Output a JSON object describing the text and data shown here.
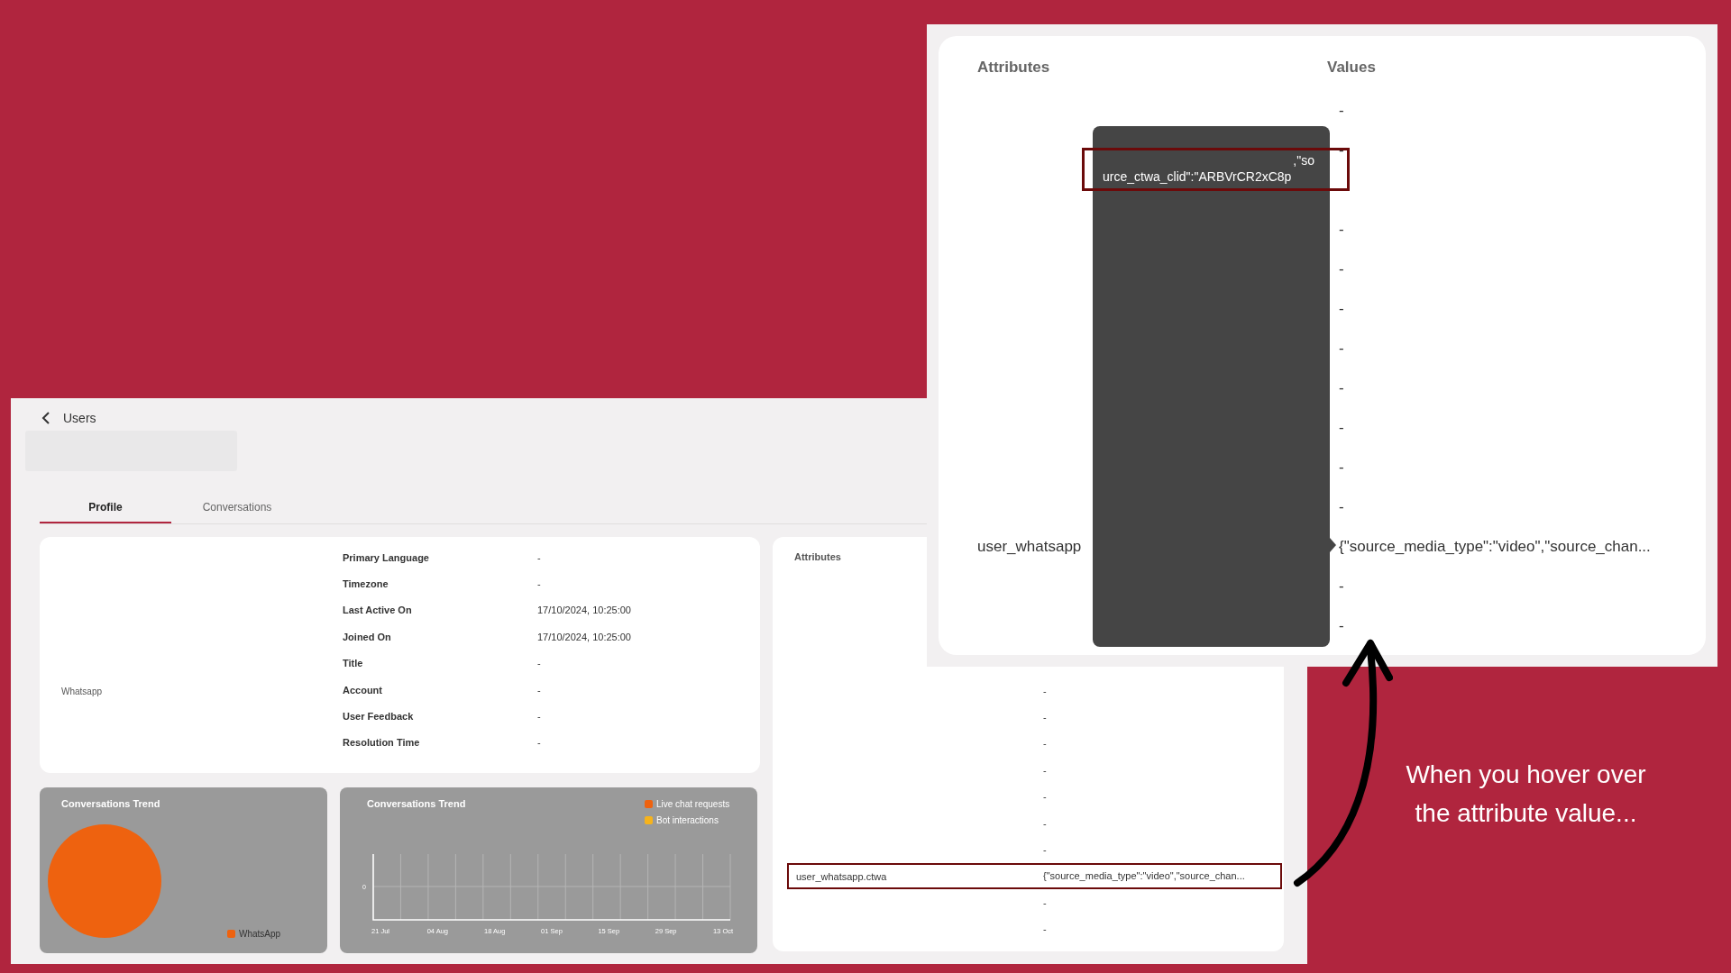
{
  "main_screen": {
    "back_link": "Users",
    "tabs": [
      {
        "label": "Profile",
        "selected": true
      },
      {
        "label": "Conversations",
        "selected": false
      }
    ],
    "profile": {
      "channel": "Whatsapp",
      "fields": [
        {
          "label": "Primary Language",
          "value": "-"
        },
        {
          "label": "Timezone",
          "value": "-"
        },
        {
          "label": "Last Active On",
          "value": "17/10/2024, 10:25:00"
        },
        {
          "label": "Joined On",
          "value": "17/10/2024, 10:25:00"
        },
        {
          "label": "Title",
          "value": "-"
        },
        {
          "label": "Account",
          "value": "-"
        },
        {
          "label": "User Feedback",
          "value": "-"
        },
        {
          "label": "Resolution Time",
          "value": "-"
        }
      ]
    },
    "charts": [
      {
        "kind": "pie",
        "title": "Conversations Trend",
        "legend": [
          {
            "label": "WhatsApp",
            "color": "#ee620f"
          }
        ]
      },
      {
        "kind": "chart",
        "chart_data": {
          "type": "other",
          "title": "Conversations Trend",
          "categories": [
            "21 Jul",
            "04 Aug",
            "18 Aug",
            "01 Sep",
            "15 Sep",
            "29 Sep",
            "13 Oct"
          ],
          "annotations": [
            {
              "text": "0"
            }
          ]
        },
        "legend": [
          {
            "label": "Live chat requests",
            "color": "#ee620f"
          },
          {
            "label": "Bot interactions",
            "color": "#f6b31c"
          }
        ]
      }
    ],
    "attributes_card": {
      "title": "Attributes",
      "rows": [
        {
          "value": "-",
          "highlighted": false
        },
        {
          "value": "-",
          "highlighted": false
        },
        {
          "value": "-",
          "highlighted": false
        },
        {
          "value": "-",
          "highlighted": false
        },
        {
          "value": "-",
          "highlighted": false
        },
        {
          "value": "-",
          "highlighted": false
        },
        {
          "value": "-",
          "highlighted": false
        },
        {
          "attribute": "user_whatsapp.ctwa",
          "value": "{\"source_media_type\":\"video\",\"source_chan...",
          "highlighted": true
        },
        {
          "value": "-",
          "highlighted": false
        },
        {
          "value": "-",
          "highlighted": false
        }
      ]
    }
  },
  "zoom_screen": {
    "headers": [
      "Attributes",
      "Values"
    ],
    "rows": [
      {
        "value": "-"
      },
      {
        "value": "-"
      },
      {},
      {
        "value": "-"
      },
      {
        "value": "-"
      },
      {
        "value": "-"
      },
      {
        "value": "-"
      },
      {
        "value": "-"
      },
      {
        "value": "-"
      },
      {
        "value": "-"
      },
      {
        "value": "-"
      },
      {
        "attribute": "user_whatsapp",
        "value": "{\"source_media_type\":\"video\",\"source_chan..."
      },
      {
        "value": "-"
      },
      {
        "value": "-"
      }
    ],
    "tooltip": {
      "lines": [
        ",\"so",
        "urce_ctwa_clid\":\"ARBVrCR2xC8p"
      ],
      "highlighted": true
    }
  },
  "caption": "When you hover over the attribute value..."
}
